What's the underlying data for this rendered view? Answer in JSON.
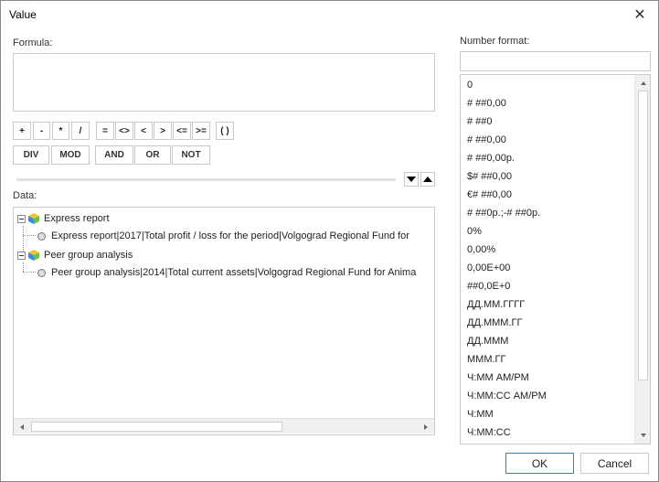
{
  "window": {
    "title": "Value",
    "close_symbol": "✕"
  },
  "formula": {
    "label": "Formula:",
    "value": ""
  },
  "operators": [
    "+",
    "-",
    "*",
    "/",
    "=",
    "<>",
    "<",
    ">",
    "<=",
    ">=",
    "( )"
  ],
  "logical_ops": [
    "DIV",
    "MOD",
    "AND",
    "OR",
    "NOT"
  ],
  "data": {
    "label": "Data:",
    "tree": [
      {
        "label": "Express report",
        "child": "Express report|2017|Total profit / loss for the period|Volgograd Regional Fund for"
      },
      {
        "label": "Peer group analysis",
        "child": "Peer group analysis|2014|Total current assets|Volgograd Regional Fund for Anima"
      }
    ]
  },
  "number_format": {
    "label": "Number format:",
    "input_value": "",
    "items": [
      "0",
      "# ##0,00",
      "# ##0",
      "# ##0,00",
      "# ##0,00р.",
      "$# ##0,00",
      "€# ##0,00",
      "# ##0р.;-# ##0р.",
      "0%",
      "0,00%",
      "0,00E+00",
      "##0,0E+0",
      "ДД.ММ.ГГГГ",
      "ДД.МММ.ГГ",
      "ДД.МММ",
      "МММ.ГГ",
      "Ч:ММ AM/PM",
      "Ч:ММ:СС AM/PM",
      "Ч:ММ",
      "Ч:ММ:СС"
    ]
  },
  "buttons": {
    "ok": "OK",
    "cancel": "Cancel"
  },
  "colors": {
    "ok_border": "#3c7fb1",
    "cube_blue": "#3b8ed8",
    "cube_yellow": "#f2c230",
    "cube_green": "#6cbf4a"
  }
}
